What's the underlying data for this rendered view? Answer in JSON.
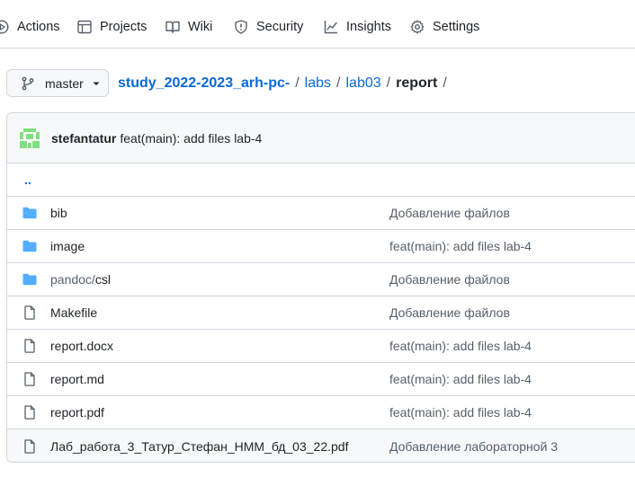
{
  "nav": {
    "items": [
      {
        "label": "Actions",
        "icon": "play-circle-icon"
      },
      {
        "label": "Projects",
        "icon": "table-icon"
      },
      {
        "label": "Wiki",
        "icon": "book-icon"
      },
      {
        "label": "Security",
        "icon": "shield-icon"
      },
      {
        "label": "Insights",
        "icon": "graph-icon"
      },
      {
        "label": "Settings",
        "icon": "gear-icon"
      }
    ]
  },
  "branch": {
    "label": "master"
  },
  "breadcrumb": {
    "repo": "study_2022-2023_arh-pc-",
    "sep": "/",
    "parts": [
      "labs",
      "lab03"
    ],
    "current": "report"
  },
  "commit": {
    "author": "stefantatur",
    "message": "feat(main): add files lab-4"
  },
  "files": {
    "updir": "..",
    "rows": [
      {
        "name": "bib",
        "type": "folder",
        "message": "Добавление файлов"
      },
      {
        "name": "image",
        "type": "folder",
        "message": "feat(main): add files lab-4"
      },
      {
        "name_prefix": "pandoc/",
        "name": "csl",
        "type": "folder",
        "message": "Добавление файлов"
      },
      {
        "name": "Makefile",
        "type": "file",
        "message": "Добавление файлов"
      },
      {
        "name": "report.docx",
        "type": "file",
        "message": "feat(main): add files lab-4"
      },
      {
        "name": "report.md",
        "type": "file",
        "message": "feat(main): add files lab-4"
      },
      {
        "name": "report.pdf",
        "type": "file",
        "message": "feat(main): add files lab-4"
      },
      {
        "name": "Лаб_работа_3_Татур_Стефан_НММ_бд_03_22.pdf",
        "type": "file",
        "message": "Добавление лабораторной 3"
      }
    ]
  },
  "colors": {
    "link": "#0969da",
    "folder": "#54aeff",
    "border": "#d0d7de",
    "avatar": "#7ee07e"
  }
}
